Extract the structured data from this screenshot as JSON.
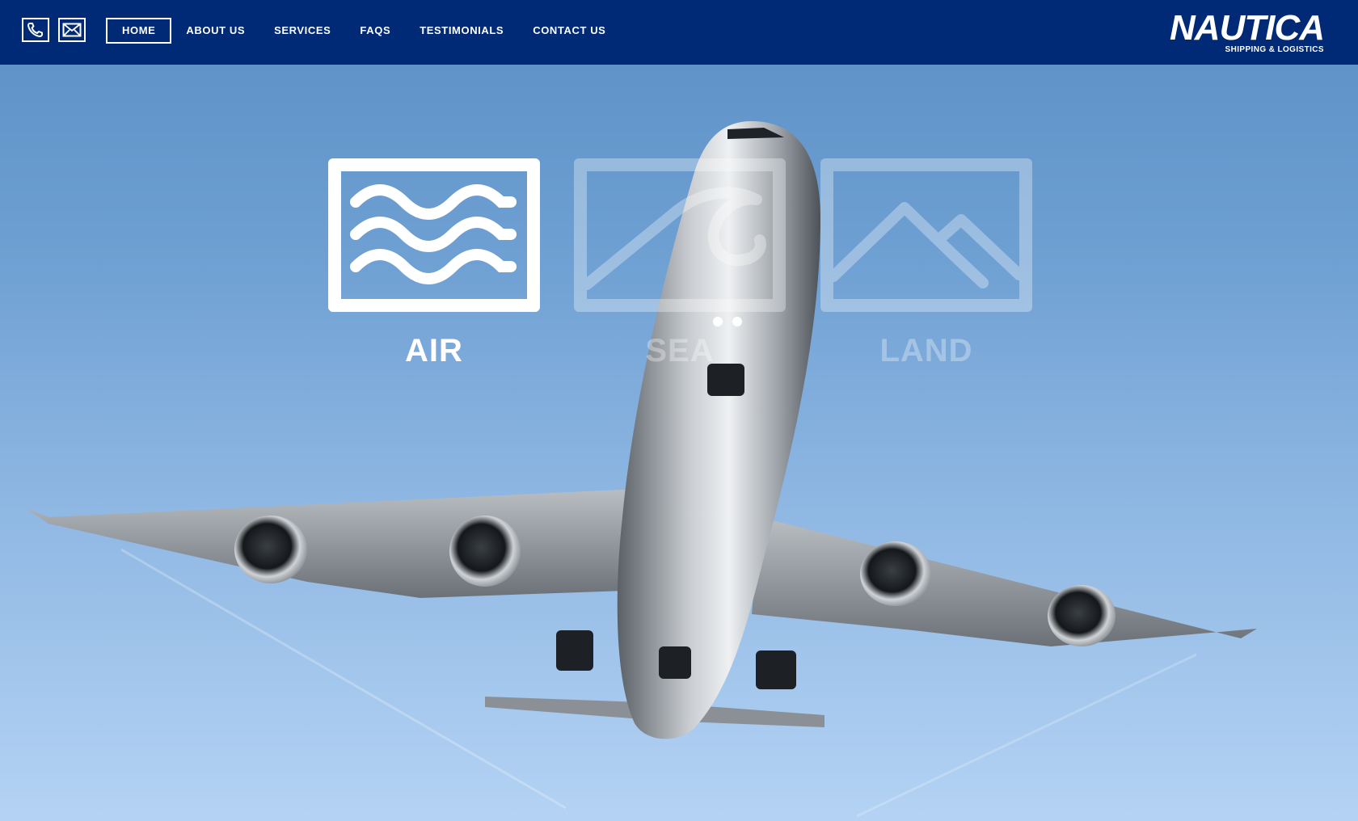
{
  "header": {
    "contact": {
      "phone_icon": "phone-icon",
      "mail_icon": "mail-icon"
    },
    "nav": [
      {
        "label": "HOME",
        "active": true
      },
      {
        "label": "ABOUT US",
        "active": false
      },
      {
        "label": "SERVICES",
        "active": false
      },
      {
        "label": "FAQS",
        "active": false
      },
      {
        "label": "TESTIMONIALS",
        "active": false
      },
      {
        "label": "CONTACT US",
        "active": false
      }
    ],
    "logo": {
      "word": "NAUTICA",
      "tagline": "SHIPPING & LOGISTICS"
    }
  },
  "hero": {
    "image": "airplane-landing-photo",
    "modes": [
      {
        "label": "AIR",
        "icon": "waves-icon",
        "selected": true
      },
      {
        "label": "SEA",
        "icon": "wave-curl-icon",
        "selected": false
      },
      {
        "label": "LAND",
        "icon": "mountains-icon",
        "selected": false
      }
    ]
  },
  "colors": {
    "header_bg": "#002a75",
    "sky_top": "#5b8fc4",
    "sky_bottom": "#b4d3f4",
    "text": "#ffffff"
  }
}
